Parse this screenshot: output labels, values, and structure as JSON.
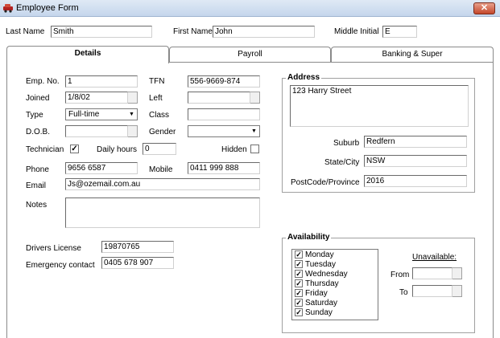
{
  "window": {
    "title": "Employee Form",
    "close_label": "✕"
  },
  "name_row": {
    "last_name_label": "Last Name",
    "last_name_value": "Smith",
    "first_name_label": "First Name",
    "first_name_value": "John",
    "middle_initial_label": "Middle Initial",
    "middle_initial_value": "E"
  },
  "tabs": [
    {
      "label": "Details"
    },
    {
      "label": "Payroll"
    },
    {
      "label": "Banking & Super"
    }
  ],
  "details": {
    "emp_no_label": "Emp. No.",
    "emp_no_value": "1",
    "tfn_label": "TFN",
    "tfn_value": "556-9669-874",
    "joined_label": "Joined",
    "joined_value": "1/8/02",
    "left_label": "Left",
    "left_value": "",
    "type_label": "Type",
    "type_value": "Full-time",
    "class_label": "Class",
    "class_value": "",
    "dob_label": "D.O.B.",
    "dob_value": "",
    "gender_label": "Gender",
    "gender_value": "",
    "technician_label": "Technician",
    "technician_checked": "✓",
    "daily_hours_label": "Daily hours",
    "daily_hours_value": "0",
    "hidden_label": "Hidden",
    "phone_label": "Phone",
    "phone_value": "9656 6587",
    "mobile_label": "Mobile",
    "mobile_value": "0411 999 888",
    "email_label": "Email",
    "email_value": "Js@ozemail.com.au",
    "notes_label": "Notes",
    "notes_value": "",
    "drivers_license_label": "Drivers License",
    "drivers_license_value": "19870765",
    "emergency_contact_label": "Emergency contact",
    "emergency_contact_value": "0405 678 907"
  },
  "address": {
    "group_title": "Address",
    "street_value": "123 Harry Street",
    "suburb_label": "Suburb",
    "suburb_value": "Redfern",
    "state_label": "State/City",
    "state_value": "NSW",
    "postcode_label": "PostCode/Province",
    "postcode_value": "2016"
  },
  "availability": {
    "group_title": "Availability",
    "check_mark": "✓",
    "days": [
      "Monday",
      "Tuesday",
      "Wednesday",
      "Thursday",
      "Friday",
      "Saturday",
      "Sunday"
    ],
    "unavailable_label": "Unavailable:",
    "from_label": "From",
    "from_value": "",
    "to_label": "To",
    "to_value": ""
  }
}
